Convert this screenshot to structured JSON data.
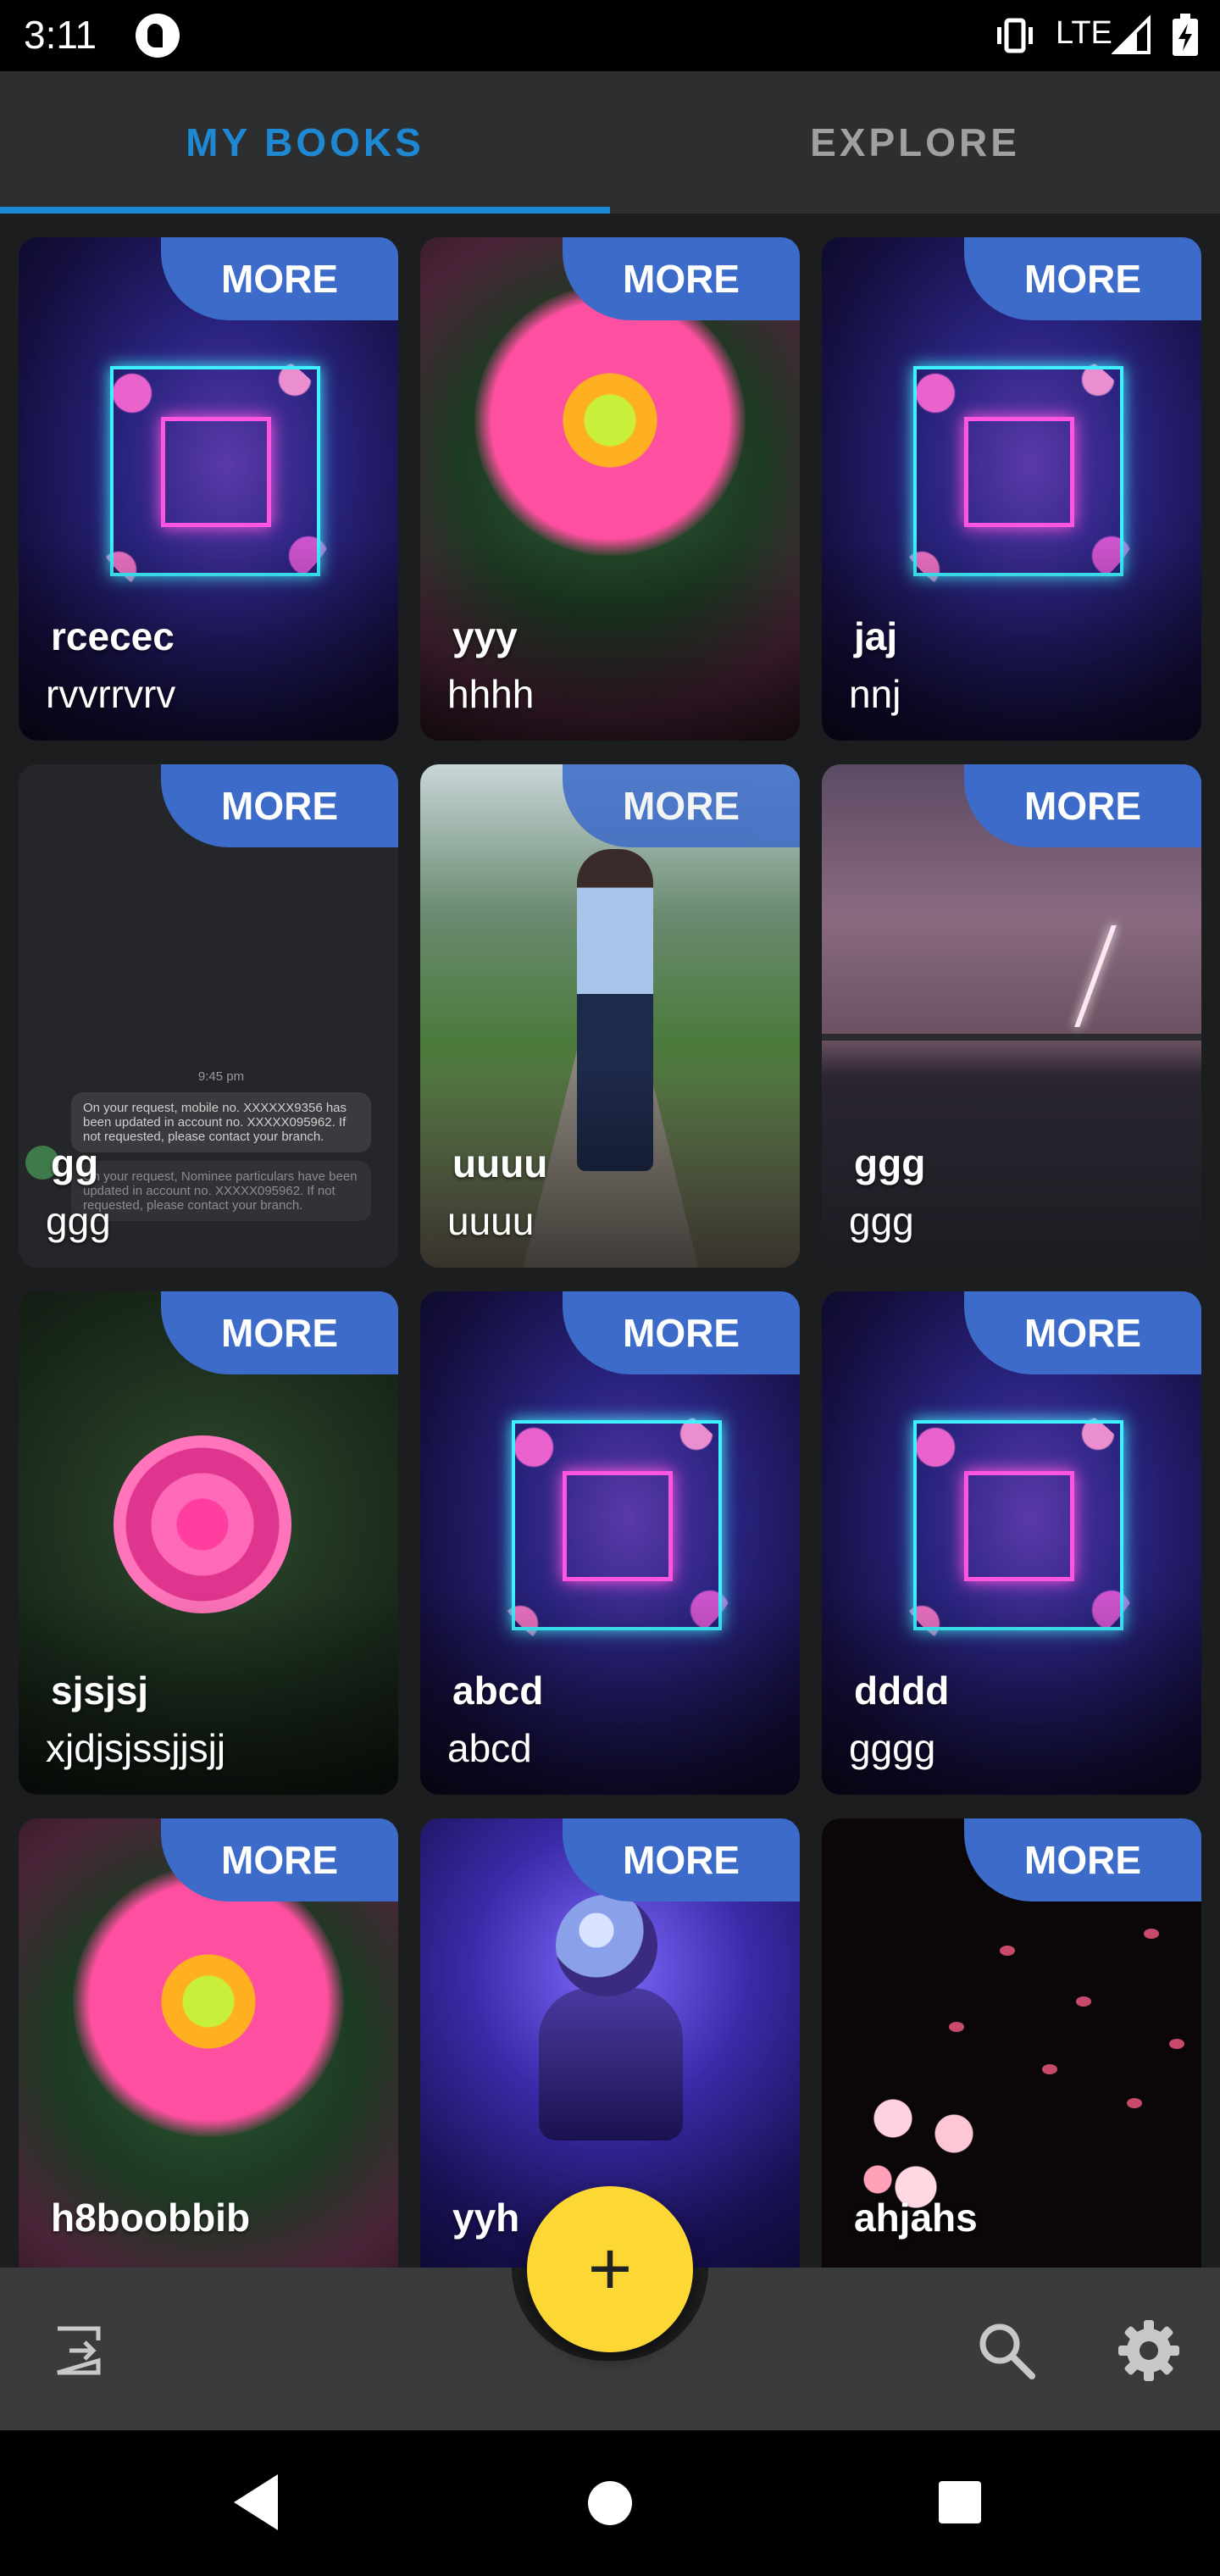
{
  "status_bar": {
    "time": "3:11",
    "network": "LTE",
    "icons": [
      "app-notification-icon",
      "vibrate-icon",
      "signal-icon",
      "battery-icon"
    ]
  },
  "tabs": [
    {
      "label": "MY BOOKS",
      "active": true
    },
    {
      "label": "EXPLORE",
      "active": false
    }
  ],
  "colors": {
    "accent": "#1e88d2",
    "more_badge": "#3c6bc9",
    "fab": "#fdd835",
    "background": "#1c1d1f"
  },
  "books": [
    {
      "title": "rcecec",
      "subtitle": "rvvrrvrv",
      "more_label": "MORE",
      "image": "neon-frame"
    },
    {
      "title": "yyy",
      "subtitle": "hhhh",
      "more_label": "MORE",
      "image": "pink-flower"
    },
    {
      "title": "jaj",
      "subtitle": "nnj",
      "more_label": "MORE",
      "image": "neon-frame"
    },
    {
      "title": "gg",
      "subtitle": "ggg",
      "more_label": "MORE",
      "image": "sms-screenshot"
    },
    {
      "title": "uuuu",
      "subtitle": "uuuu",
      "more_label": "MORE",
      "image": "person-garden"
    },
    {
      "title": "ggg",
      "subtitle": "ggg",
      "more_label": "MORE",
      "image": "storm-lightning"
    },
    {
      "title": "sjsjsj",
      "subtitle": "xjdjsjssjjsjj",
      "more_label": "MORE",
      "image": "pink-rose"
    },
    {
      "title": "abcd",
      "subtitle": "abcd",
      "more_label": "MORE",
      "image": "neon-frame"
    },
    {
      "title": "dddd",
      "subtitle": "gggg",
      "more_label": "MORE",
      "image": "neon-frame"
    },
    {
      "title": "h8boobbib",
      "subtitle": "",
      "more_label": "MORE",
      "image": "pink-flower"
    },
    {
      "title": "yyh",
      "subtitle": "",
      "more_label": "MORE",
      "image": "astronaut"
    },
    {
      "title": "ahjahs",
      "subtitle": "",
      "more_label": "MORE",
      "image": "cherry-blossom"
    }
  ],
  "sms_preview": {
    "time": "9:45 pm",
    "message_1": "On your request, mobile no. XXXXXX9356 has been updated in account no. XXXXX095962. If not requested, please contact your branch.",
    "message_2": "On your request, Nominee particulars have been updated in account no. XXXXX095962. If not requested, please contact your branch."
  },
  "bottom_bar": {
    "fab_label": "+",
    "icons": [
      "exit-icon",
      "search-icon",
      "settings-icon"
    ]
  },
  "nav_bar": {
    "icons": [
      "back-icon",
      "home-icon",
      "recents-icon"
    ]
  }
}
